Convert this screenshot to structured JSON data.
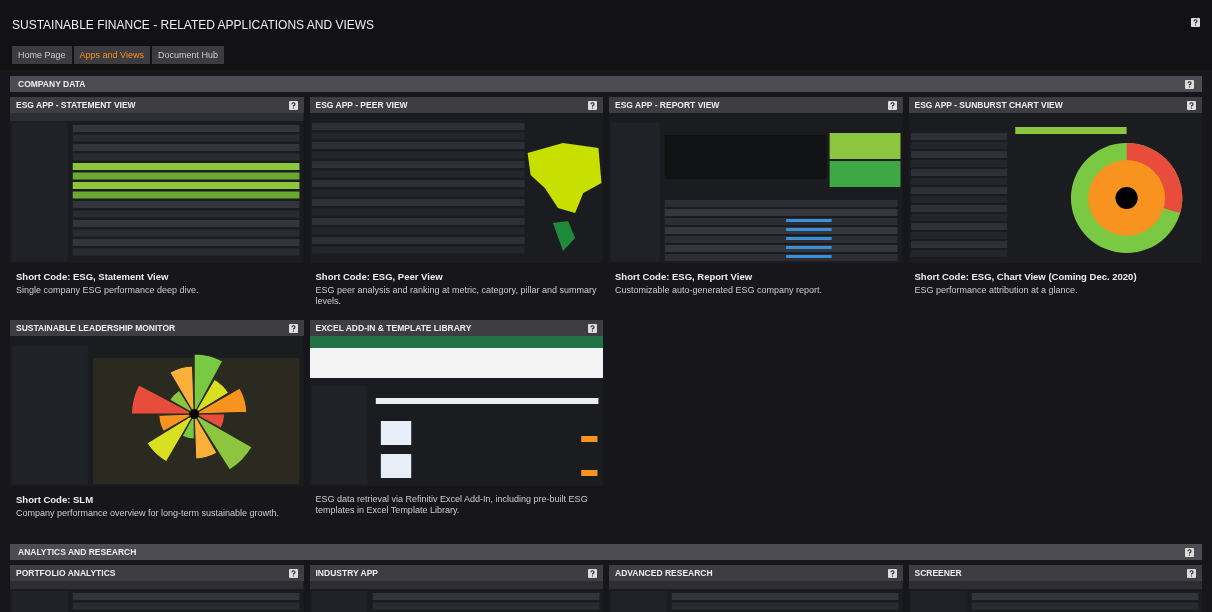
{
  "header": {
    "title": "SUSTAINABLE FINANCE - RELATED APPLICATIONS AND VIEWS"
  },
  "tabs": [
    {
      "label": "Home Page",
      "selected": false
    },
    {
      "label": "Apps and Views",
      "selected": true
    },
    {
      "label": "Document Hub",
      "selected": false
    }
  ],
  "sections": [
    {
      "title": "COMPANY DATA",
      "cards": [
        {
          "title": "ESG APP - STATEMENT VIEW",
          "kind": "table",
          "short_code": "Short Code: ESG, Statement View",
          "description": "Single company ESG performance deep dive."
        },
        {
          "title": "ESG APP - PEER VIEW",
          "kind": "map",
          "short_code": "Short Code: ESG, Peer View",
          "description": "ESG peer analysis and ranking at metric, category, pillar and summary levels."
        },
        {
          "title": "ESG APP - REPORT VIEW",
          "kind": "report",
          "short_code": "Short Code: ESG, Report View",
          "description": "Customizable auto-generated ESG company report."
        },
        {
          "title": "ESG APP - SUNBURST CHART VIEW",
          "kind": "sunburst",
          "short_code": "Short Code: ESG, Chart View (Coming Dec. 2020)",
          "description": "ESG performance attribution at a glance."
        },
        {
          "title": "SUSTAINABLE LEADERSHIP MONITOR",
          "kind": "radar",
          "short_code": "Short Code: SLM",
          "description": "Company performance overview for long-term sustainable growth."
        },
        {
          "title": "EXCEL ADD-IN & TEMPLATE LIBRARY",
          "kind": "excel",
          "description": "ESG data retrieval via Refinitiv Excel Add-In, including pre-built ESG templates in Excel Template Library."
        }
      ]
    },
    {
      "title": "ANALYTICS AND RESEARCH",
      "cards": [
        {
          "title": "PORTFOLIO ANALYTICS",
          "kind": "table"
        },
        {
          "title": "INDUSTRY APP",
          "kind": "table"
        },
        {
          "title": "ADVANCED RESEARCH",
          "kind": "table"
        },
        {
          "title": "SCREENER",
          "kind": "table"
        }
      ]
    }
  ]
}
